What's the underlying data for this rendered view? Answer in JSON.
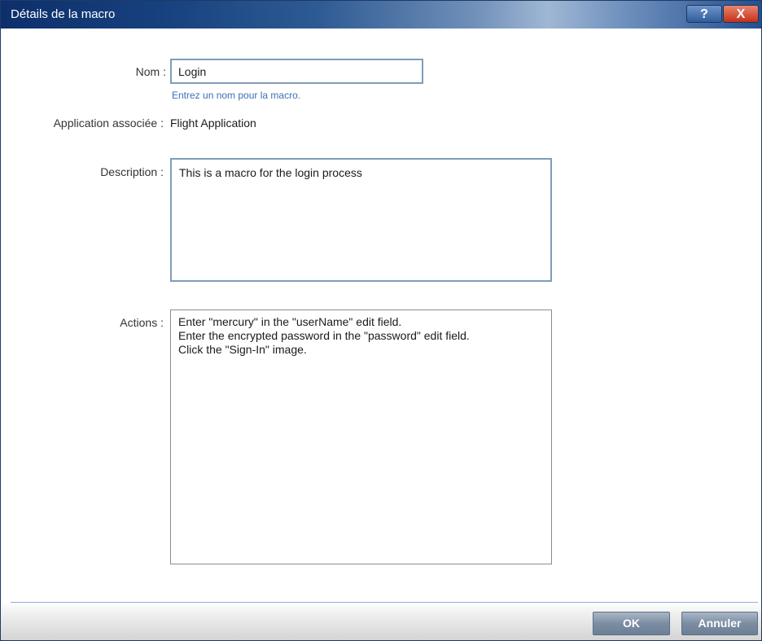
{
  "window": {
    "title": "Détails de la macro",
    "help_label": "?",
    "close_label": "X"
  },
  "form": {
    "name_label": "Nom :",
    "name_value": "Login",
    "name_hint": "Entrez un nom pour la macro.",
    "app_label": "Application associée :",
    "app_value": "Flight Application",
    "description_label": "Description :",
    "description_value": "This is a macro for the login process",
    "actions_label": "Actions :",
    "actions": [
      "Enter \"mercury\" in the \"userName\" edit field.",
      "Enter the encrypted password in the \"password\" edit field.",
      "Click the \"Sign-In\" image."
    ]
  },
  "buttons": {
    "ok": "OK",
    "cancel": "Annuler"
  },
  "colors": {
    "hint_text": "#3b6fb6",
    "field_border": "#7f9db9",
    "button_fill": "#7b8da3"
  }
}
